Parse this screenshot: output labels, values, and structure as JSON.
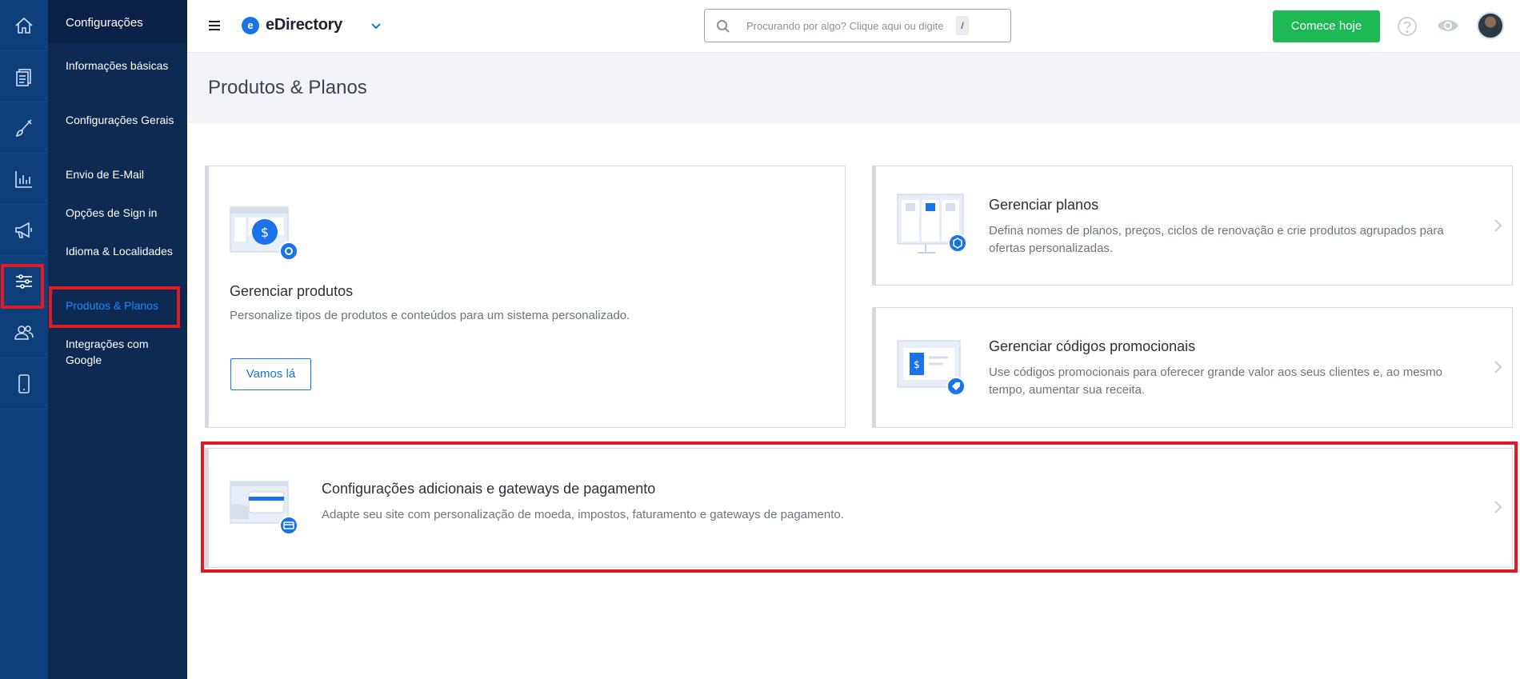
{
  "rail": {
    "items": [
      {
        "icon": "home-icon"
      },
      {
        "icon": "documents-icon"
      },
      {
        "icon": "brush-icon"
      },
      {
        "icon": "chart-icon"
      },
      {
        "icon": "megaphone-icon"
      },
      {
        "icon": "sliders-icon"
      },
      {
        "icon": "users-icon"
      },
      {
        "icon": "mobile-icon"
      }
    ]
  },
  "subnav": {
    "title": "Configurações",
    "items": [
      {
        "label": "Informações básicas"
      },
      {
        "label": "Configurações Gerais"
      },
      {
        "label": "Envio de E-Mail"
      },
      {
        "label": "Opções de Sign in"
      },
      {
        "label": "Idioma & Localidades"
      },
      {
        "label": "Produtos & Planos"
      },
      {
        "label": "Integrações com Google"
      }
    ]
  },
  "header": {
    "logo_letter": "e",
    "logo_text": "eDirectory",
    "search_placeholder": "Procurando por algo? Clique aqui ou digite",
    "search_shortcut": "/",
    "cta_label": "Comece hoje"
  },
  "page": {
    "title": "Produtos & Planos"
  },
  "cards": {
    "products": {
      "title": "Gerenciar produtos",
      "desc": "Personalize tipos de produtos e conteúdos para um sistema personalizado.",
      "button": "Vamos lá"
    },
    "plans": {
      "title": "Gerenciar planos",
      "desc": "Defina nomes de planos, preços, ciclos de renovação e crie produtos agrupados para ofertas personalizadas."
    },
    "promo": {
      "title": "Gerenciar códigos promocionais",
      "desc": "Use códigos promocionais para oferecer grande valor aos seus clientes e, ao mesmo tempo, aumentar sua receita."
    },
    "payments": {
      "title": "Configurações adicionais e gateways de pagamento",
      "desc": "Adapte seu site com personalização de moeda, impostos, faturamento e gateways de pagamento."
    }
  },
  "colors": {
    "rail_bg": "#0f3f7a",
    "subnav_bg": "#0d2a52",
    "accent": "#1a73e8",
    "cta": "#1db954",
    "highlight": "#e01b24"
  }
}
